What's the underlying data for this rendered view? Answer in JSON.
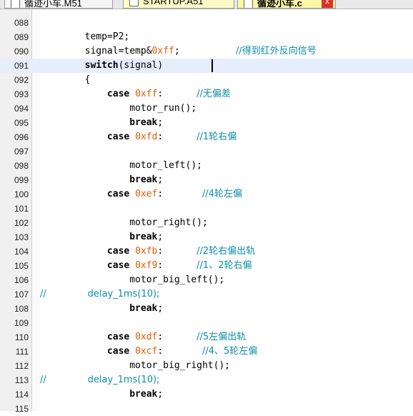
{
  "tabs": [
    {
      "label": "循迹小车.M51"
    },
    {
      "label": "STARTUP.A51"
    },
    {
      "label": "循迹小车.c"
    }
  ],
  "tab_close_glyph": "x",
  "lines": [
    {
      "num": "088",
      "parts": []
    },
    {
      "num": "089",
      "parts": [
        {
          "t": "        temp=P2;",
          "c": "txt"
        }
      ]
    },
    {
      "num": "090",
      "parts": [
        {
          "t": "        signal=temp&",
          "c": "txt"
        },
        {
          "t": "0xff",
          "c": "num"
        },
        {
          "t": ";          ",
          "c": "txt"
        },
        {
          "t": "//得到红外反向信号",
          "c": "cmt"
        }
      ]
    },
    {
      "num": "091",
      "current": true,
      "parts": [
        {
          "t": "        ",
          "c": "txt"
        },
        {
          "t": "switch",
          "c": "kw"
        },
        {
          "t": "(signal)",
          "c": "txt"
        }
      ]
    },
    {
      "num": "092",
      "parts": [
        {
          "t": "        {",
          "c": "txt"
        }
      ]
    },
    {
      "num": "093",
      "parts": [
        {
          "t": "            ",
          "c": "txt"
        },
        {
          "t": "case",
          "c": "kw"
        },
        {
          "t": " ",
          "c": "txt"
        },
        {
          "t": "0xff",
          "c": "num"
        },
        {
          "t": ":      ",
          "c": "txt"
        },
        {
          "t": "//无偏差",
          "c": "cmt"
        }
      ]
    },
    {
      "num": "094",
      "parts": [
        {
          "t": "                motor_run();",
          "c": "txt"
        }
      ]
    },
    {
      "num": "095",
      "parts": [
        {
          "t": "                ",
          "c": "txt"
        },
        {
          "t": "break",
          "c": "kw"
        },
        {
          "t": ";",
          "c": "txt"
        }
      ]
    },
    {
      "num": "096",
      "parts": [
        {
          "t": "            ",
          "c": "txt"
        },
        {
          "t": "case",
          "c": "kw"
        },
        {
          "t": " ",
          "c": "txt"
        },
        {
          "t": "0xfd",
          "c": "num"
        },
        {
          "t": ":      ",
          "c": "txt"
        },
        {
          "t": "//1轮右偏",
          "c": "cmt"
        }
      ]
    },
    {
      "num": "097",
      "parts": []
    },
    {
      "num": "098",
      "parts": [
        {
          "t": "                motor_left();",
          "c": "txt"
        }
      ]
    },
    {
      "num": "099",
      "parts": [
        {
          "t": "                ",
          "c": "txt"
        },
        {
          "t": "break",
          "c": "kw"
        },
        {
          "t": ";",
          "c": "txt"
        }
      ]
    },
    {
      "num": "100",
      "parts": [
        {
          "t": "            ",
          "c": "txt"
        },
        {
          "t": "case",
          "c": "kw"
        },
        {
          "t": " ",
          "c": "txt"
        },
        {
          "t": "0xef",
          "c": "num"
        },
        {
          "t": ":       ",
          "c": "txt"
        },
        {
          "t": "//4轮左偏",
          "c": "cmt"
        }
      ]
    },
    {
      "num": "101",
      "parts": []
    },
    {
      "num": "102",
      "parts": [
        {
          "t": "                motor_right();",
          "c": "txt"
        }
      ]
    },
    {
      "num": "103",
      "parts": [
        {
          "t": "                ",
          "c": "txt"
        },
        {
          "t": "break",
          "c": "kw"
        },
        {
          "t": ";",
          "c": "txt"
        }
      ]
    },
    {
      "num": "104",
      "parts": [
        {
          "t": "            ",
          "c": "txt"
        },
        {
          "t": "case",
          "c": "kw"
        },
        {
          "t": " ",
          "c": "txt"
        },
        {
          "t": "0xfb",
          "c": "num"
        },
        {
          "t": ":      ",
          "c": "txt"
        },
        {
          "t": "//2轮右偏出轨",
          "c": "cmt"
        }
      ]
    },
    {
      "num": "105",
      "parts": [
        {
          "t": "            ",
          "c": "txt"
        },
        {
          "t": "case",
          "c": "kw"
        },
        {
          "t": " ",
          "c": "txt"
        },
        {
          "t": "0xf9",
          "c": "num"
        },
        {
          "t": ":      ",
          "c": "txt"
        },
        {
          "t": "//1、2轮右偏",
          "c": "cmt"
        }
      ]
    },
    {
      "num": "106",
      "parts": [
        {
          "t": "                motor_big_left();",
          "c": "txt"
        }
      ]
    },
    {
      "num": "107",
      "parts": [
        {
          "t": "//              ",
          "c": "cmt"
        },
        {
          "t": "delay_1ms(10);",
          "c": "cmt"
        }
      ]
    },
    {
      "num": "108",
      "parts": [
        {
          "t": "                ",
          "c": "txt"
        },
        {
          "t": "break",
          "c": "kw"
        },
        {
          "t": ";",
          "c": "txt"
        }
      ]
    },
    {
      "num": "109",
      "parts": []
    },
    {
      "num": "110",
      "parts": [
        {
          "t": "            ",
          "c": "txt"
        },
        {
          "t": "case",
          "c": "kw"
        },
        {
          "t": " ",
          "c": "txt"
        },
        {
          "t": "0xdf",
          "c": "num"
        },
        {
          "t": ":      ",
          "c": "txt"
        },
        {
          "t": "//5左偏出轨",
          "c": "cmt"
        }
      ]
    },
    {
      "num": "111",
      "parts": [
        {
          "t": "            ",
          "c": "txt"
        },
        {
          "t": "case",
          "c": "kw"
        },
        {
          "t": " ",
          "c": "txt"
        },
        {
          "t": "0xcf",
          "c": "num"
        },
        {
          "t": ":       ",
          "c": "txt"
        },
        {
          "t": "//4、5轮左偏",
          "c": "cmt"
        }
      ]
    },
    {
      "num": "112",
      "parts": [
        {
          "t": "                motor_big_right();",
          "c": "txt"
        }
      ]
    },
    {
      "num": "113",
      "parts": [
        {
          "t": "//              ",
          "c": "cmt"
        },
        {
          "t": "delay_1ms(10);",
          "c": "cmt"
        }
      ]
    },
    {
      "num": "114",
      "parts": [
        {
          "t": "                ",
          "c": "txt"
        },
        {
          "t": "break",
          "c": "kw"
        },
        {
          "t": ";",
          "c": "txt"
        }
      ]
    },
    {
      "num": "115",
      "parts": []
    }
  ]
}
